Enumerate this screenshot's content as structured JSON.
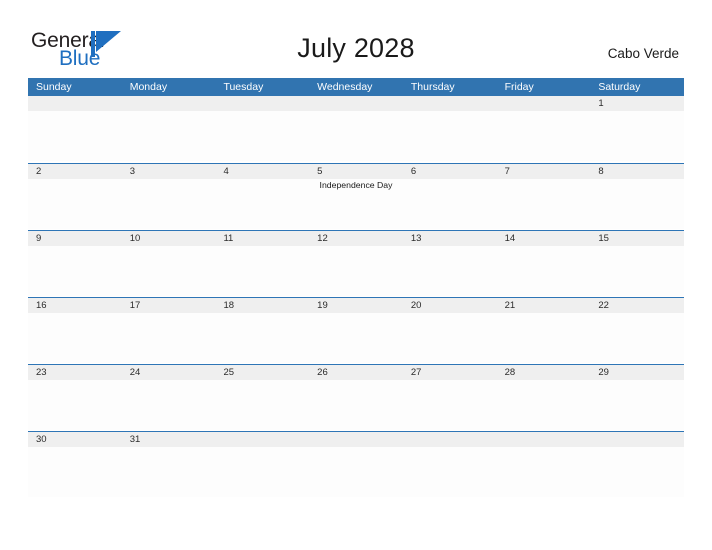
{
  "brand": {
    "name_part1": "General",
    "name_part2": "Blue",
    "mark_icon": "triangle-flag-icon",
    "mark_color": "#1f6fc0",
    "blue_text_color": "#1f6fc0",
    "general_text_color": "#231f20"
  },
  "header": {
    "title": "July 2028",
    "location": "Cabo Verde"
  },
  "theme": {
    "header_blue": "#3174b0",
    "row_divider_blue": "#2e75b6",
    "daynum_band_gray": "#efefef",
    "page_background": "#ffffff"
  },
  "calendar": {
    "month": "July",
    "year": "2028",
    "weekday_headers": [
      "Sunday",
      "Monday",
      "Tuesday",
      "Wednesday",
      "Thursday",
      "Friday",
      "Saturday"
    ],
    "weeks": [
      {
        "days": [
          {
            "number": "",
            "event": ""
          },
          {
            "number": "",
            "event": ""
          },
          {
            "number": "",
            "event": ""
          },
          {
            "number": "",
            "event": ""
          },
          {
            "number": "",
            "event": ""
          },
          {
            "number": "",
            "event": ""
          },
          {
            "number": "1",
            "event": ""
          }
        ]
      },
      {
        "days": [
          {
            "number": "2",
            "event": ""
          },
          {
            "number": "3",
            "event": ""
          },
          {
            "number": "4",
            "event": ""
          },
          {
            "number": "5",
            "event": "Independence Day"
          },
          {
            "number": "6",
            "event": ""
          },
          {
            "number": "7",
            "event": ""
          },
          {
            "number": "8",
            "event": ""
          }
        ]
      },
      {
        "days": [
          {
            "number": "9",
            "event": ""
          },
          {
            "number": "10",
            "event": ""
          },
          {
            "number": "11",
            "event": ""
          },
          {
            "number": "12",
            "event": ""
          },
          {
            "number": "13",
            "event": ""
          },
          {
            "number": "14",
            "event": ""
          },
          {
            "number": "15",
            "event": ""
          }
        ]
      },
      {
        "days": [
          {
            "number": "16",
            "event": ""
          },
          {
            "number": "17",
            "event": ""
          },
          {
            "number": "18",
            "event": ""
          },
          {
            "number": "19",
            "event": ""
          },
          {
            "number": "20",
            "event": ""
          },
          {
            "number": "21",
            "event": ""
          },
          {
            "number": "22",
            "event": ""
          }
        ]
      },
      {
        "days": [
          {
            "number": "23",
            "event": ""
          },
          {
            "number": "24",
            "event": ""
          },
          {
            "number": "25",
            "event": ""
          },
          {
            "number": "26",
            "event": ""
          },
          {
            "number": "27",
            "event": ""
          },
          {
            "number": "28",
            "event": ""
          },
          {
            "number": "29",
            "event": ""
          }
        ]
      },
      {
        "days": [
          {
            "number": "30",
            "event": ""
          },
          {
            "number": "31",
            "event": ""
          },
          {
            "number": "",
            "event": ""
          },
          {
            "number": "",
            "event": ""
          },
          {
            "number": "",
            "event": ""
          },
          {
            "number": "",
            "event": ""
          },
          {
            "number": "",
            "event": ""
          }
        ]
      }
    ]
  }
}
